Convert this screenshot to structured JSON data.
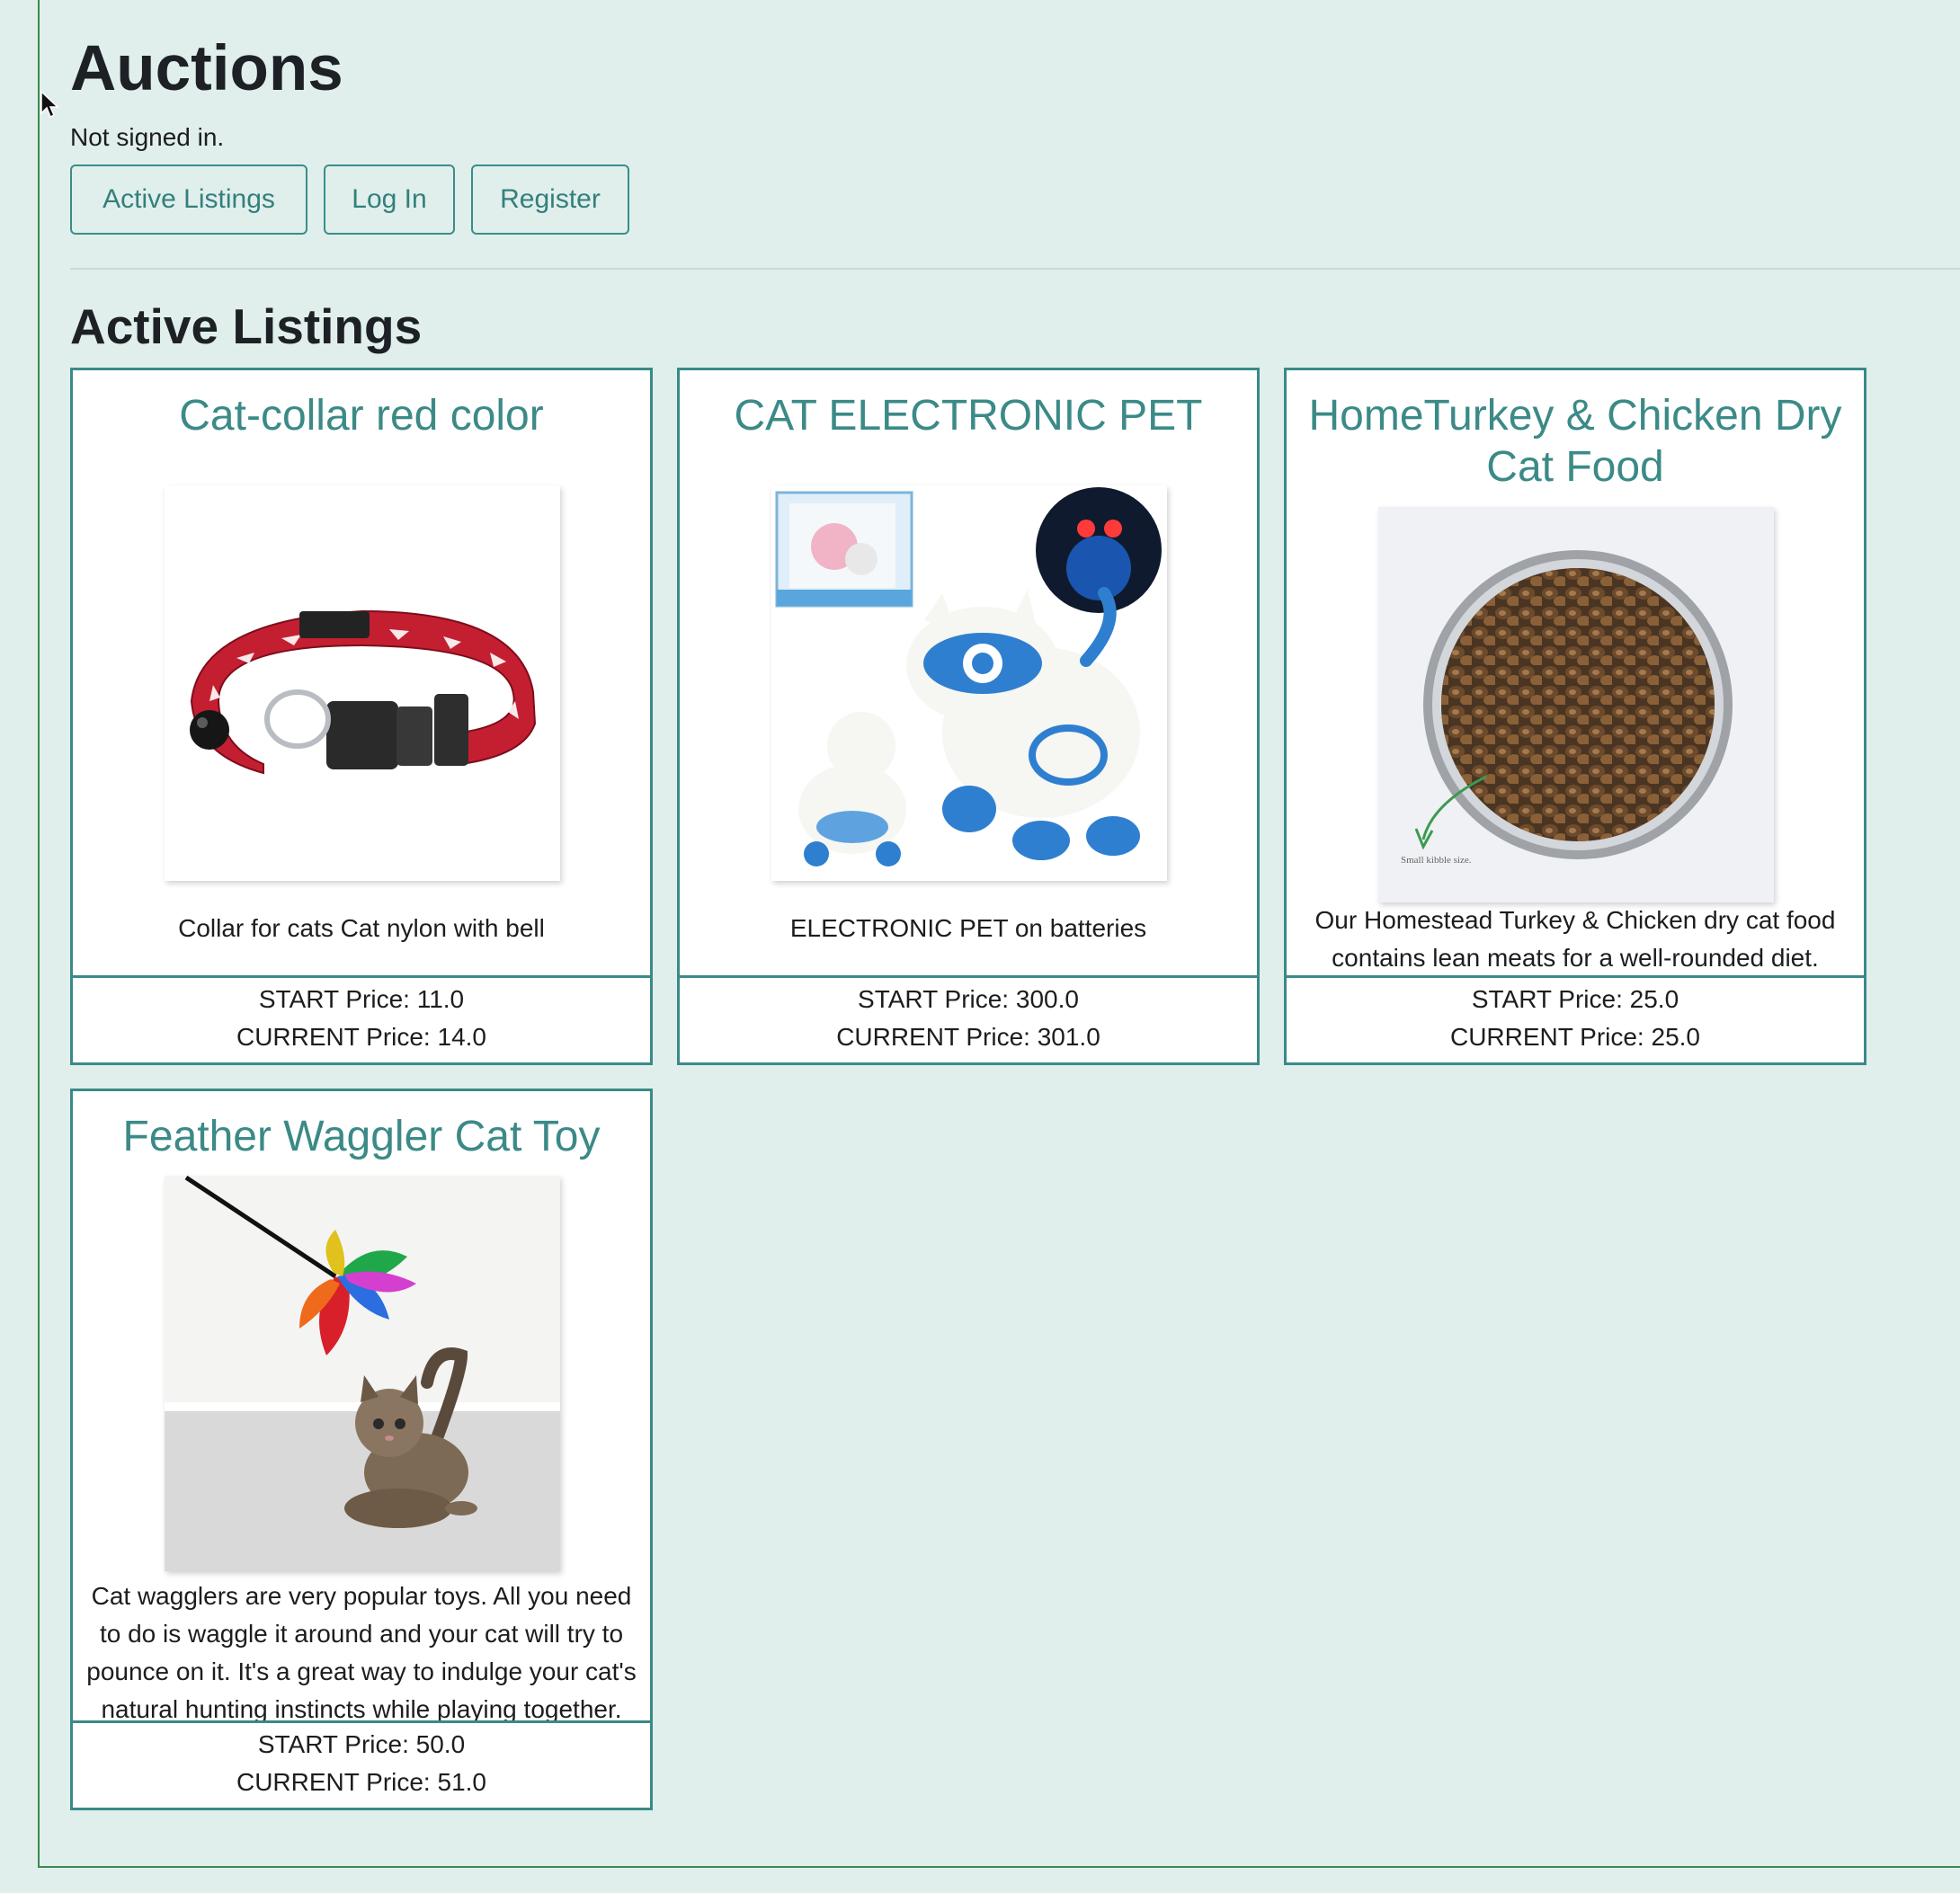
{
  "header": {
    "title": "Auctions",
    "signin_status": "Not signed in."
  },
  "nav": {
    "active_listings": "Active Listings",
    "login": "Log In",
    "register": "Register"
  },
  "main": {
    "section_title": "Active Listings",
    "listings": [
      {
        "title": "Cat-collar red color",
        "description": "Collar for cats Cat nylon with bell",
        "start_price": "START Price: 11.0",
        "current_price": "CURRENT Price: 14.0",
        "image": "red-cat-collar-photo"
      },
      {
        "title": "CAT ELECTRONIC PET",
        "description": "ELECTRONIC PET on batteries",
        "start_price": "START Price: 300.0",
        "current_price": "CURRENT Price: 301.0",
        "image": "robot-cat-toy-photo"
      },
      {
        "title": "HomeTurkey & Chicken Dry Cat Food",
        "description": "Our Homestead Turkey & Chicken dry cat food contains lean meats for a well-rounded diet.",
        "start_price": "START Price: 25.0",
        "current_price": "CURRENT Price: 25.0",
        "image": "kibble-bowl-photo",
        "image_caption": "Small kibble size."
      },
      {
        "title": "Feather Waggler Cat Toy",
        "description": "Cat wagglers are very popular toys. All you need to do is waggle it around and your cat will try to pounce on it. It's a great way to indulge your cat's natural hunting instincts while playing together.",
        "start_price": "START Price: 50.0",
        "current_price": "CURRENT Price: 51.0",
        "image": "feather-toy-kitten-photo"
      }
    ]
  },
  "colors": {
    "page_background": "#e0efec",
    "accent": "#3b8a87",
    "card_border": "#3a8a87",
    "frame_border": "#3c8a4e"
  }
}
